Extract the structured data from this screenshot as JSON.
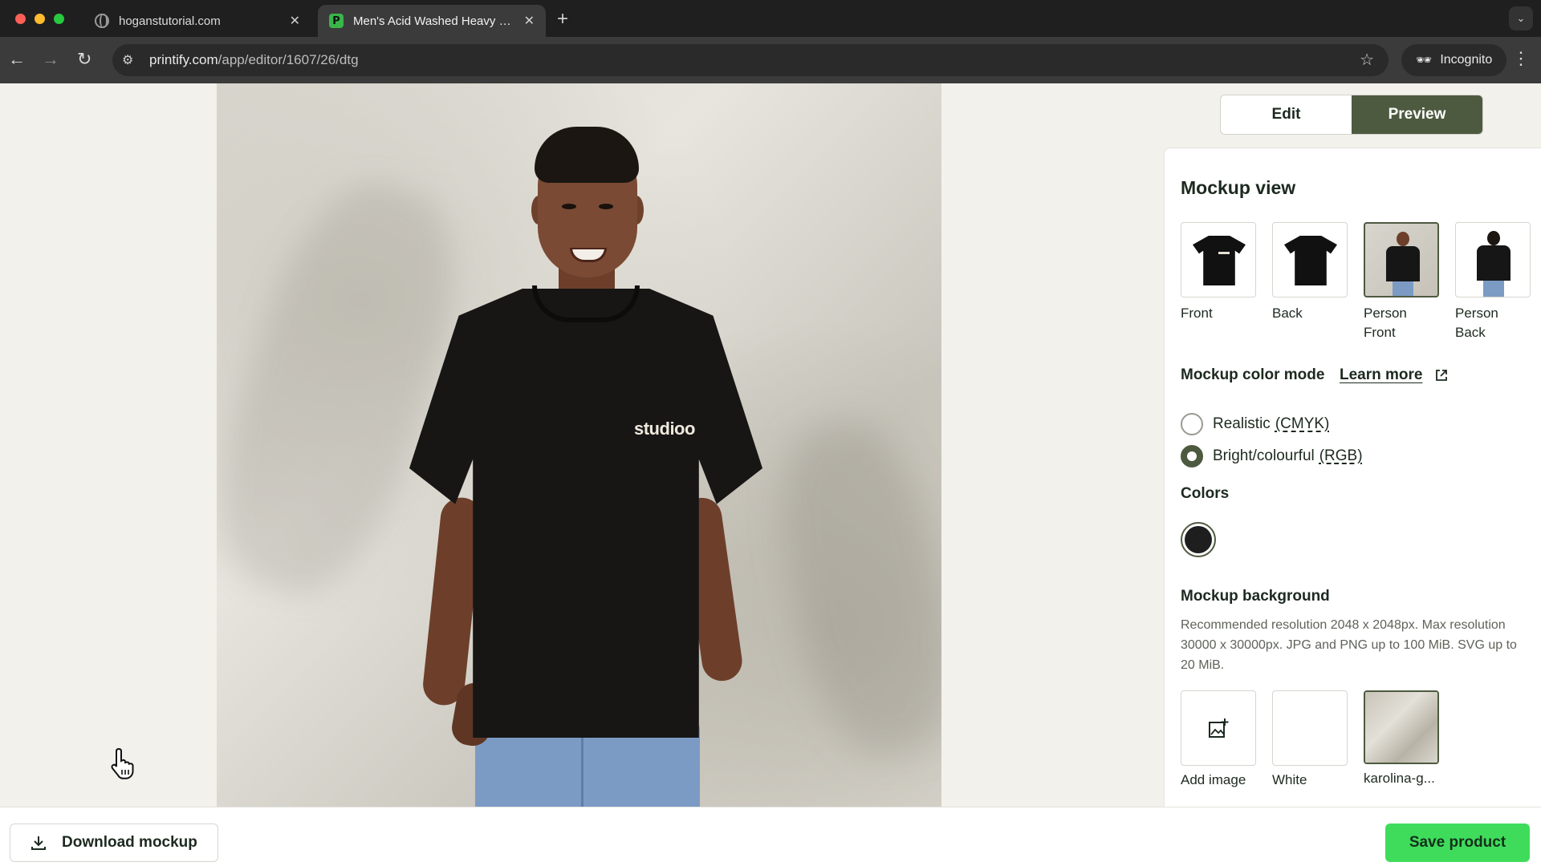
{
  "browser": {
    "tabs": [
      {
        "title": "hoganstutorial.com",
        "active": false
      },
      {
        "title": "Men's Acid Washed Heavy Oversized Tee",
        "active": true
      }
    ],
    "url_host": "printify.com",
    "url_path": "/app/editor/1607/26/dtg",
    "incognito_label": "Incognito"
  },
  "toggle": {
    "edit_label": "Edit",
    "preview_label": "Preview",
    "active": "Preview"
  },
  "mockup": {
    "shirt_print": "studioo"
  },
  "panel": {
    "title": "Mockup view",
    "views": [
      {
        "label": "Front"
      },
      {
        "label": "Back"
      },
      {
        "label": "Person Front",
        "selected": true
      },
      {
        "label": "Person Back"
      }
    ],
    "color_mode": {
      "label": "Mockup color mode",
      "learn_more": "Learn more",
      "options": [
        {
          "label": "Realistic",
          "abbr": "(CMYK)",
          "checked": false
        },
        {
          "label": "Bright/colourful",
          "abbr": "(RGB)",
          "checked": true
        }
      ]
    },
    "colors": {
      "label": "Colors",
      "selected_color": "#1e1e1e"
    },
    "background": {
      "label": "Mockup background",
      "description": "Recommended resolution 2048 x 2048px. Max resolution 30000 x 30000px. JPG and PNG up to 100 MiB. SVG up to 20 MiB.",
      "options": [
        {
          "label": "Add image"
        },
        {
          "label": "White"
        },
        {
          "label": "karolina-g..."
        }
      ]
    }
  },
  "bottombar": {
    "download_label": "Download mockup",
    "save_label": "Save product"
  },
  "colors": {
    "accent": "#4d5a40",
    "save_green": "#3fdc5c"
  }
}
